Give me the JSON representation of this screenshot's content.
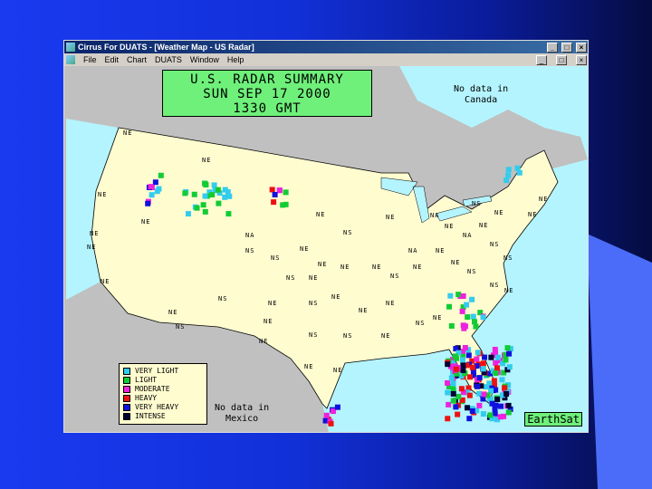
{
  "window": {
    "title": "Cirrus For DUATS - [Weather Map - US Radar]",
    "controls": [
      "_",
      "□",
      "×"
    ]
  },
  "menu": {
    "items": [
      "File",
      "Edit",
      "Chart",
      "DUATS",
      "Window",
      "Help"
    ],
    "controls": [
      "_",
      "□",
      "×"
    ]
  },
  "map": {
    "title_lines": [
      "U.S. RADAR SUMMARY",
      "SUN SEP 17 2000",
      "1330 GMT"
    ],
    "canada_note": [
      "No data in",
      "Canada"
    ],
    "mexico_note": [
      "No data in",
      "Mexico"
    ],
    "area_labels": [
      "NE",
      "NE",
      "NE",
      "NE",
      "NE",
      "NE",
      "NE",
      "NA",
      "NS",
      "NS",
      "NE",
      "NE",
      "NE",
      "NS",
      "NE",
      "NA",
      "NE",
      "NS",
      "NE",
      "NA",
      "NS",
      "NE",
      "NS",
      "NE",
      "NE",
      "NS",
      "NE",
      "NE",
      "NE",
      "NS",
      "NE",
      "NA",
      "NE",
      "NE",
      "NS",
      "NS",
      "NE",
      "NS",
      "NE",
      "NS",
      "NE",
      "NE",
      "NE",
      "NS",
      "NE",
      "NE",
      "NS",
      "NE",
      "NS",
      "NS",
      "NE",
      "NE",
      "NE",
      "NE"
    ],
    "brand": "EarthSat",
    "colors": {
      "water": "#b4f4ff",
      "us_land": "#fffcd0",
      "foreign_land": "#c0c0c0",
      "title_box": "#6ef07a"
    }
  },
  "legend": [
    {
      "label": "VERY LIGHT",
      "color": "#33ccee"
    },
    {
      "label": "LIGHT",
      "color": "#11cc33"
    },
    {
      "label": "MODERATE",
      "color": "#ee22dd"
    },
    {
      "label": "HEAVY",
      "color": "#ee1111"
    },
    {
      "label": "VERY HEAVY",
      "color": "#1111dd"
    },
    {
      "label": "INTENSE",
      "color": "#000033"
    }
  ]
}
